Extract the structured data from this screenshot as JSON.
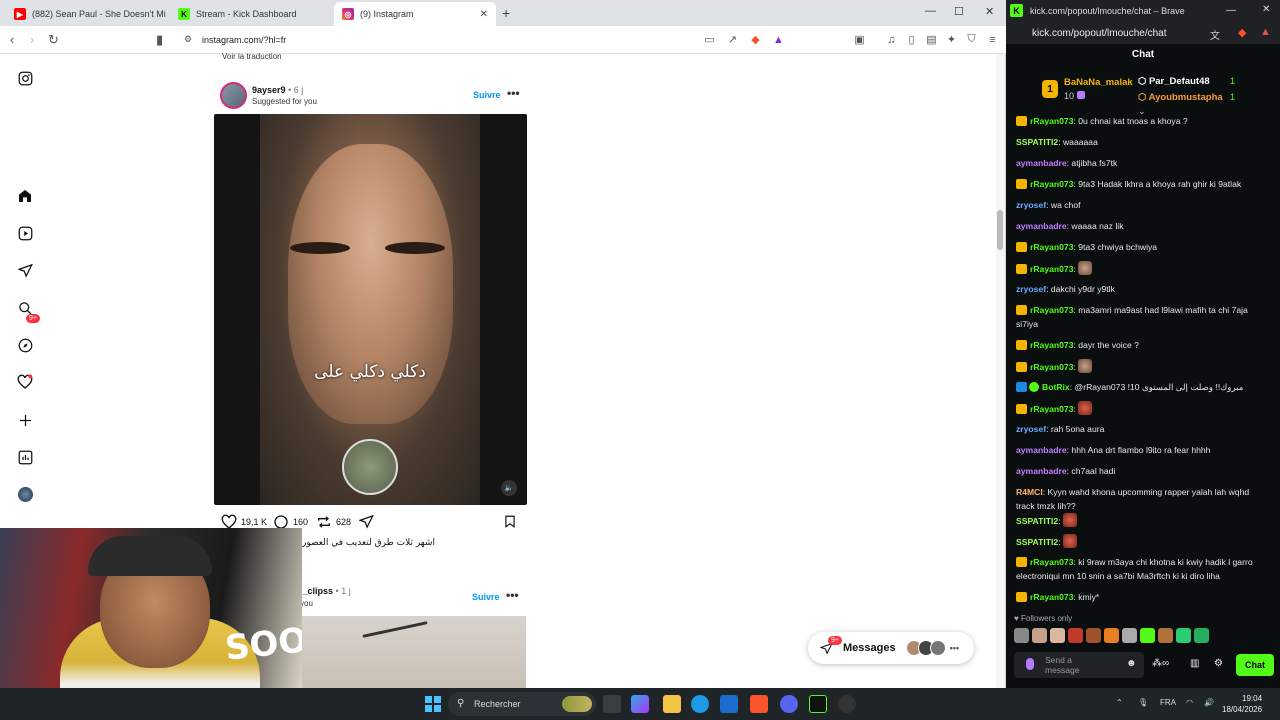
{
  "tabs": [
    {
      "label": "(882) Sean Paul - She Doesn't Mind |",
      "active": false
    },
    {
      "label": "Stream - Kick Dashboard",
      "active": false
    },
    {
      "label": "(9) Instagram",
      "active": true
    }
  ],
  "left_url": "instagram.com/?hl=fr",
  "right_window": {
    "title": "kick.com/popout/lmouche/chat – Brave",
    "url": "kick.com/popout/lmouche/chat"
  },
  "instagram": {
    "notif_badge": "9+",
    "voir_traduction": "Voir la traduction",
    "post1": {
      "username": "9ayser9",
      "time": "• 6 j",
      "suggested": "Suggested for you",
      "follow_label": "Suivre",
      "video_caption": "دكلي دكلي على",
      "likes": "19,1 K",
      "comments": "160",
      "reposts": "628",
      "caption": "اشهر ثلات طرق لتعديب في العصور"
    },
    "post2": {
      "username": "i_clipss",
      "time": "• 1 j",
      "suggested": "you",
      "follow_label": "Suivre"
    },
    "messages": {
      "label": "Messages",
      "badge": "9+"
    }
  },
  "webcam": {
    "soon_text": "SOON"
  },
  "chat": {
    "header": "Chat",
    "leaderboard": [
      {
        "rank": "1",
        "name": "BaNaNa_malak",
        "points": "10"
      },
      {
        "rank": "",
        "name": "Par_Defaut48",
        "points": "1"
      },
      {
        "rank": "",
        "name": "Ayoubmustapha",
        "points": "1"
      }
    ],
    "messages": [
      {
        "user": "rRayan073",
        "text": ": 0u chnai kat tnoas a khoya ?",
        "color": "#53fc18",
        "crown": true
      },
      {
        "user": "SSPATITI2",
        "text": ": waaaaaa",
        "color": "#9eff5a",
        "crown": false
      },
      {
        "user": "aymanbadre",
        "text": ": atjibha fs7tk",
        "color": "#c77dff",
        "crown": false
      },
      {
        "user": "rRayan073",
        "text": ": 9ta3 Hadak lkhra a khoya rah ghir ki 9atlak",
        "color": "#53fc18",
        "crown": true
      },
      {
        "user": "zryosef",
        "text": ": wa chof",
        "color": "#6fa8ff",
        "crown": false
      },
      {
        "user": "aymanbadre",
        "text": ": waaaa naz lik",
        "color": "#c77dff",
        "crown": false
      },
      {
        "user": "rRayan073",
        "text": ": 9ta3 chwiya bchwiya",
        "color": "#53fc18",
        "crown": true
      },
      {
        "user": "rRayan073",
        "text": ":",
        "color": "#53fc18",
        "crown": true,
        "emote": true
      },
      {
        "user": "zryosef",
        "text": ": dakchi y9dr y9tlk",
        "color": "#6fa8ff",
        "crown": false
      },
      {
        "user": "rRayan073",
        "text": ": ma3amri ma9ast had l9lawi mafih ta chi 7aja si7iya",
        "color": "#53fc18",
        "crown": true
      },
      {
        "user": "rRayan073",
        "text": ": dayr the voice ?",
        "color": "#53fc18",
        "crown": true
      },
      {
        "user": "rRayan073",
        "text": ":",
        "color": "#53fc18",
        "crown": true,
        "emote": true
      },
      {
        "user": "BotRix",
        "text": ": @rRayan073 !مبروك!! وصلت إلى المستوى 10",
        "color": "#53fc18",
        "crown": false,
        "bot": true
      },
      {
        "user": "rRayan073",
        "text": ":",
        "color": "#53fc18",
        "crown": true,
        "emote": true,
        "emote_red": true
      },
      {
        "user": "zryosef",
        "text": ": rah 5ona aura",
        "color": "#6fa8ff",
        "crown": false
      },
      {
        "user": "aymanbadre",
        "text": ": hhh Ana drt flambo l9ito ra fear hhhh",
        "color": "#c77dff",
        "crown": false
      },
      {
        "user": "aymanbadre",
        "text": ": ch7aal hadi",
        "color": "#c77dff",
        "crown": false
      },
      {
        "user": "R4MCI",
        "text": ": Kyyn wahd khona upcomming rapper yalah lah wqhd track tmzk lih??",
        "color": "#ffb36b",
        "crown": false
      },
      {
        "user": "SSPATITI2",
        "text": ":",
        "color": "#9eff5a",
        "crown": false,
        "emote": true,
        "emote_red": true
      },
      {
        "user": "SSPATITI2",
        "text": ":",
        "color": "#9eff5a",
        "crown": false,
        "emote": true,
        "emote_red": true
      },
      {
        "user": "rRayan073",
        "text": ": ki 9raw m3aya chi khotna ki kwiy hadik l garro electroniqui mn 10 snin a sa7bi Ma3rftch ki ki diro liha",
        "color": "#53fc18",
        "crown": true
      },
      {
        "user": "rRayan073",
        "text": ": kmiy*",
        "color": "#53fc18",
        "crown": true
      }
    ],
    "followers_only": "Followers only",
    "send_placeholder": "Send a message",
    "chat_button": "Chat"
  },
  "taskbar": {
    "search": "Rechercher",
    "lang": "FRA",
    "time": "19:04",
    "date": "18/04/2026"
  }
}
